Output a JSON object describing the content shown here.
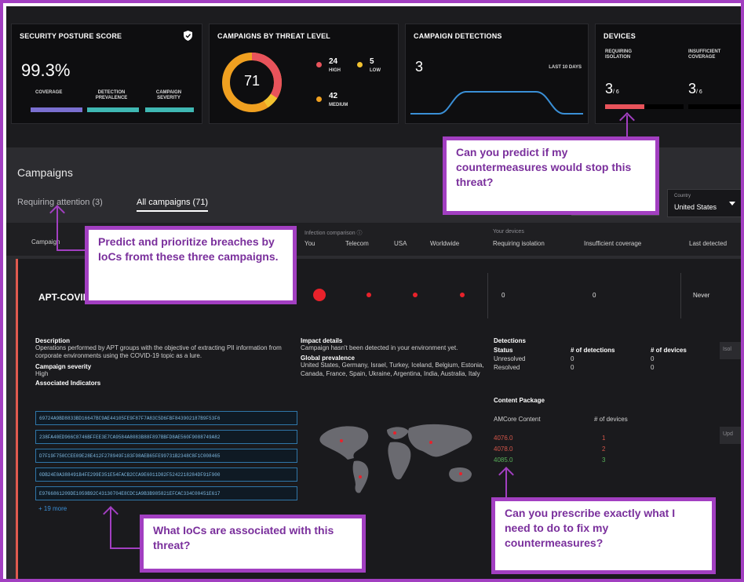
{
  "kpis": {
    "posture": {
      "title": "SECURITY POSTURE SCORE",
      "icon": "shield-icon",
      "value": "99.3%",
      "labels": [
        "COVERAGE",
        "DETECTION PREVALENCE",
        "CAMPAIGN SEVERITY"
      ],
      "bar_colors": [
        "#7a6fd0",
        "#3fb8b3",
        "#3fb8b3"
      ]
    },
    "threat_level": {
      "title": "CAMPAIGNS BY THREAT LEVEL",
      "total": "71",
      "high_count": "24",
      "high_label": "HIGH",
      "low_count": "5",
      "low_label": "LOW",
      "medium_count": "42",
      "medium_label": "MEDIUM",
      "colors": {
        "high": "#e8535b",
        "low": "#f2c230",
        "medium": "#f0a020"
      }
    },
    "detections": {
      "title": "CAMPAIGN DETECTIONS",
      "value": "3",
      "period": "LAST 10 DAYS",
      "line_color": "#3a8fd6"
    },
    "devices": {
      "title": "DEVICES",
      "isolation_label": "REQUIRING ISOLATION",
      "isolation_value": "3",
      "isolation_total": "/ 6",
      "coverage_label": "INSUFFICIENT COVERAGE",
      "coverage_value": "3",
      "coverage_total": "/ 6",
      "isolation_fraction": 0.5,
      "bar_color": "#e8535b"
    }
  },
  "campaigns": {
    "section_title": "Campaigns",
    "tabs": [
      "Requiring attention (3)",
      "All campaigns (71)"
    ],
    "country_label": "Country",
    "country_value": "United States",
    "headers": {
      "campaign": "Campaign",
      "infection_group": "Infection comparison",
      "devices_group": "Your devices",
      "you": "You",
      "telecom": "Telecom",
      "usa": "USA",
      "worldwide": "Worldwide",
      "requiring_isolation": "Requiring isolation",
      "insufficient_coverage": "Insufficient coverage",
      "last_detected": "Last detected"
    },
    "row": {
      "name": "APT-COVID",
      "requiring_isolation": "0",
      "insufficient_coverage": "0",
      "last_detected": "Never"
    },
    "details": {
      "description_h": "Description",
      "description": "Operations performed by APT groups with the objective of extracting PII information from corporate environments using the COVID-19 topic as a lure.",
      "severity_h": "Campaign severity",
      "severity": "High",
      "indicators_h": "Associated Indicators",
      "indicators": [
        "69724A9BD8833BD16647BC9AE44105FE9F87F7A83C5D6FBF843902187B9F53F6",
        "238FA40ED966C8746BFFEE3E7CA9584A8083B88F897BBFD8AE560F9088749A82",
        "D7F19F750CCEE09E28E412F278949F183F98AEB65FE99731B2348C8F1C008465",
        "0DB24E0A388491B4FE299E351E54FACB2CCA9E6011D82F5242218284DF91F900",
        "E9766861209DE1059B92C43130704E8CDC1A9B3B985821EFCAC334C00451E617"
      ],
      "more": "+ 19 more",
      "impact_h": "Impact details",
      "impact": "Campaign hasn't been detected in your environment yet.",
      "prevalence_h": "Global prevalence",
      "prevalence": "United States, Germany, Israel, Turkey, Iceland, Belgium, Estonia, Canada, France, Spain, Ukraine, Argentina, India, Australia, Italy",
      "detections_h": "Detections",
      "status_h": "Status",
      "num_detections_h": "# of detections",
      "num_devices_h": "# of devices",
      "unresolved": "Unresolved",
      "resolved": "Resolved",
      "unresolved_det": "0",
      "unresolved_dev": "0",
      "resolved_det": "0",
      "resolved_dev": "0",
      "content_h": "Content Package",
      "amcore_h": "AMCore Content",
      "pkg_devices_h": "# of devices",
      "packages": [
        {
          "version": "4076.0",
          "devices": "1",
          "color": "#d4564a"
        },
        {
          "version": "4078.0",
          "devices": "2",
          "color": "#d4564a"
        },
        {
          "version": "4085.0",
          "devices": "3",
          "color": "#58b05a"
        }
      ],
      "btn_isolate": "Isol",
      "btn_update": "Upd"
    }
  },
  "callouts": {
    "predict_countermeasures": "Can you predict if my countermeasures would stop this threat?",
    "prioritize": "Predict and prioritize breaches by IoCs fromt these three campaigns.",
    "iocs": "What IoCs are associated with this threat?",
    "prescribe": "Can you prescribe exactly what I need to do to fix my countermeasures?"
  }
}
